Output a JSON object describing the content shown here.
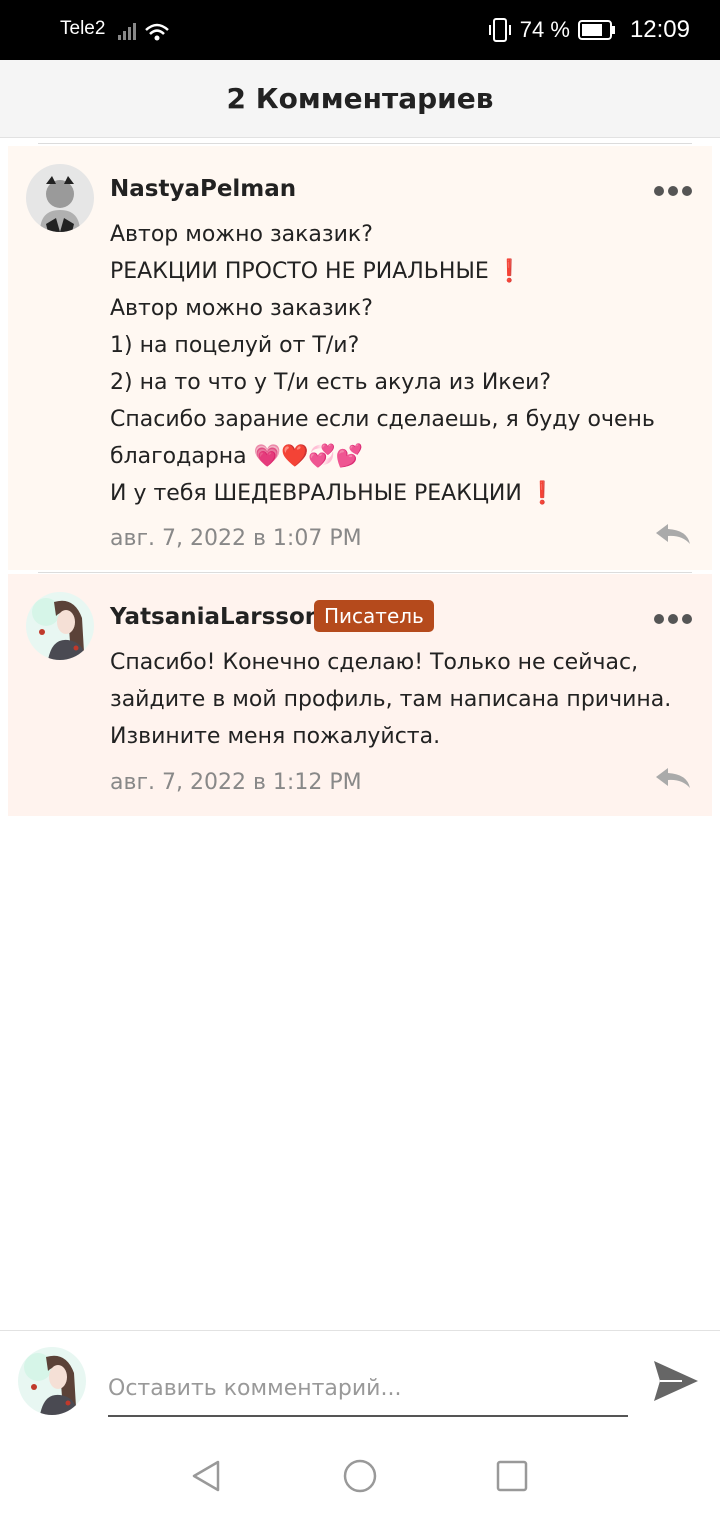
{
  "status_bar": {
    "carrier": "Tele2",
    "battery": "74 %",
    "time": "12:09"
  },
  "header": {
    "title": "2 Комментариев"
  },
  "comments": [
    {
      "author": "NastyaPelman",
      "lines": [
        "Автор можно заказик?",
        "РЕАКЦИИ ПРОСТО НЕ РИАЛЬНЫЕ ❗",
        "Автор можно заказик?",
        "1) на поцелуй от Т/и?",
        "2) на то что у Т/и есть акула из Икеи?",
        "Спасибо зарание если сделаешь, я буду очень",
        "благодарна 💗❤️💞💕",
        "И у тебя ШЕДЕВРАЛЬНЫЕ РЕАКЦИИ ❗"
      ],
      "timestamp": "авг. 7, 2022 в 1:07 PM"
    },
    {
      "author": "YatsaniaLarsson",
      "badge": "Писатель",
      "lines": [
        "Спасибо! Конечно сделаю! Только не сейчас,",
        "зайдите в мой профиль, там написана причина.",
        "Извините меня пожалуйста."
      ],
      "timestamp": "авг. 7, 2022 в 1:12 PM"
    }
  ],
  "composer": {
    "placeholder": "Оставить комментарий..."
  },
  "colors": {
    "badge": "#b54a1c",
    "comment_bg_1": "#fff8f2",
    "comment_bg_2": "#fff3ee"
  }
}
